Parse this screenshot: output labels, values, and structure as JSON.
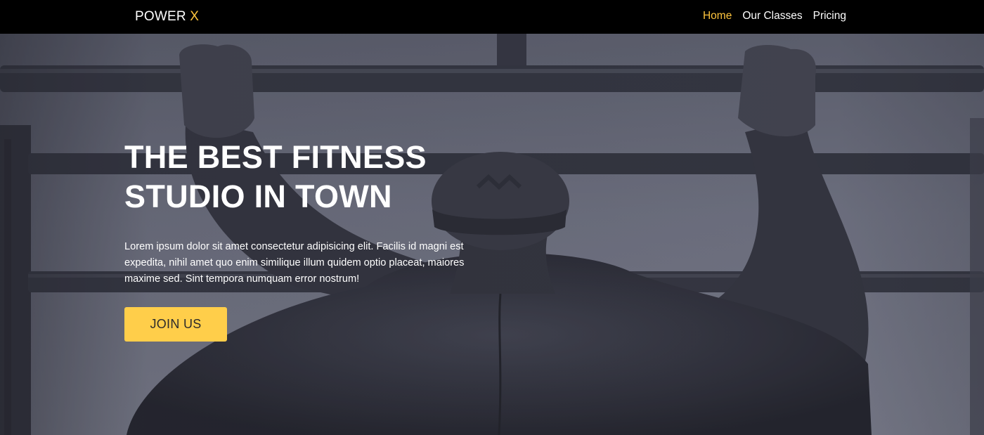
{
  "brand": {
    "name": "POWER",
    "accent": "X"
  },
  "nav": {
    "items": [
      {
        "label": "Home",
        "active": true
      },
      {
        "label": "Our Classes",
        "active": false
      },
      {
        "label": "Pricing",
        "active": false
      }
    ]
  },
  "hero": {
    "title_line1": "THE BEST FITNESS",
    "title_line2": "STUDIO IN TOWN",
    "text": "Lorem ipsum dolor sit amet consectetur adipisicing elit. Facilis id magni est expedita, nihil amet quo enim similique illum quidem optio placeat, maiores maxime sed. Sint tempora numquam error nostrum!",
    "button_label": "JOIN US"
  },
  "colors": {
    "accent": "#ffc53d",
    "button": "#ffce4a",
    "navbar": "#000000",
    "hero_overlay": "#5d6170"
  }
}
